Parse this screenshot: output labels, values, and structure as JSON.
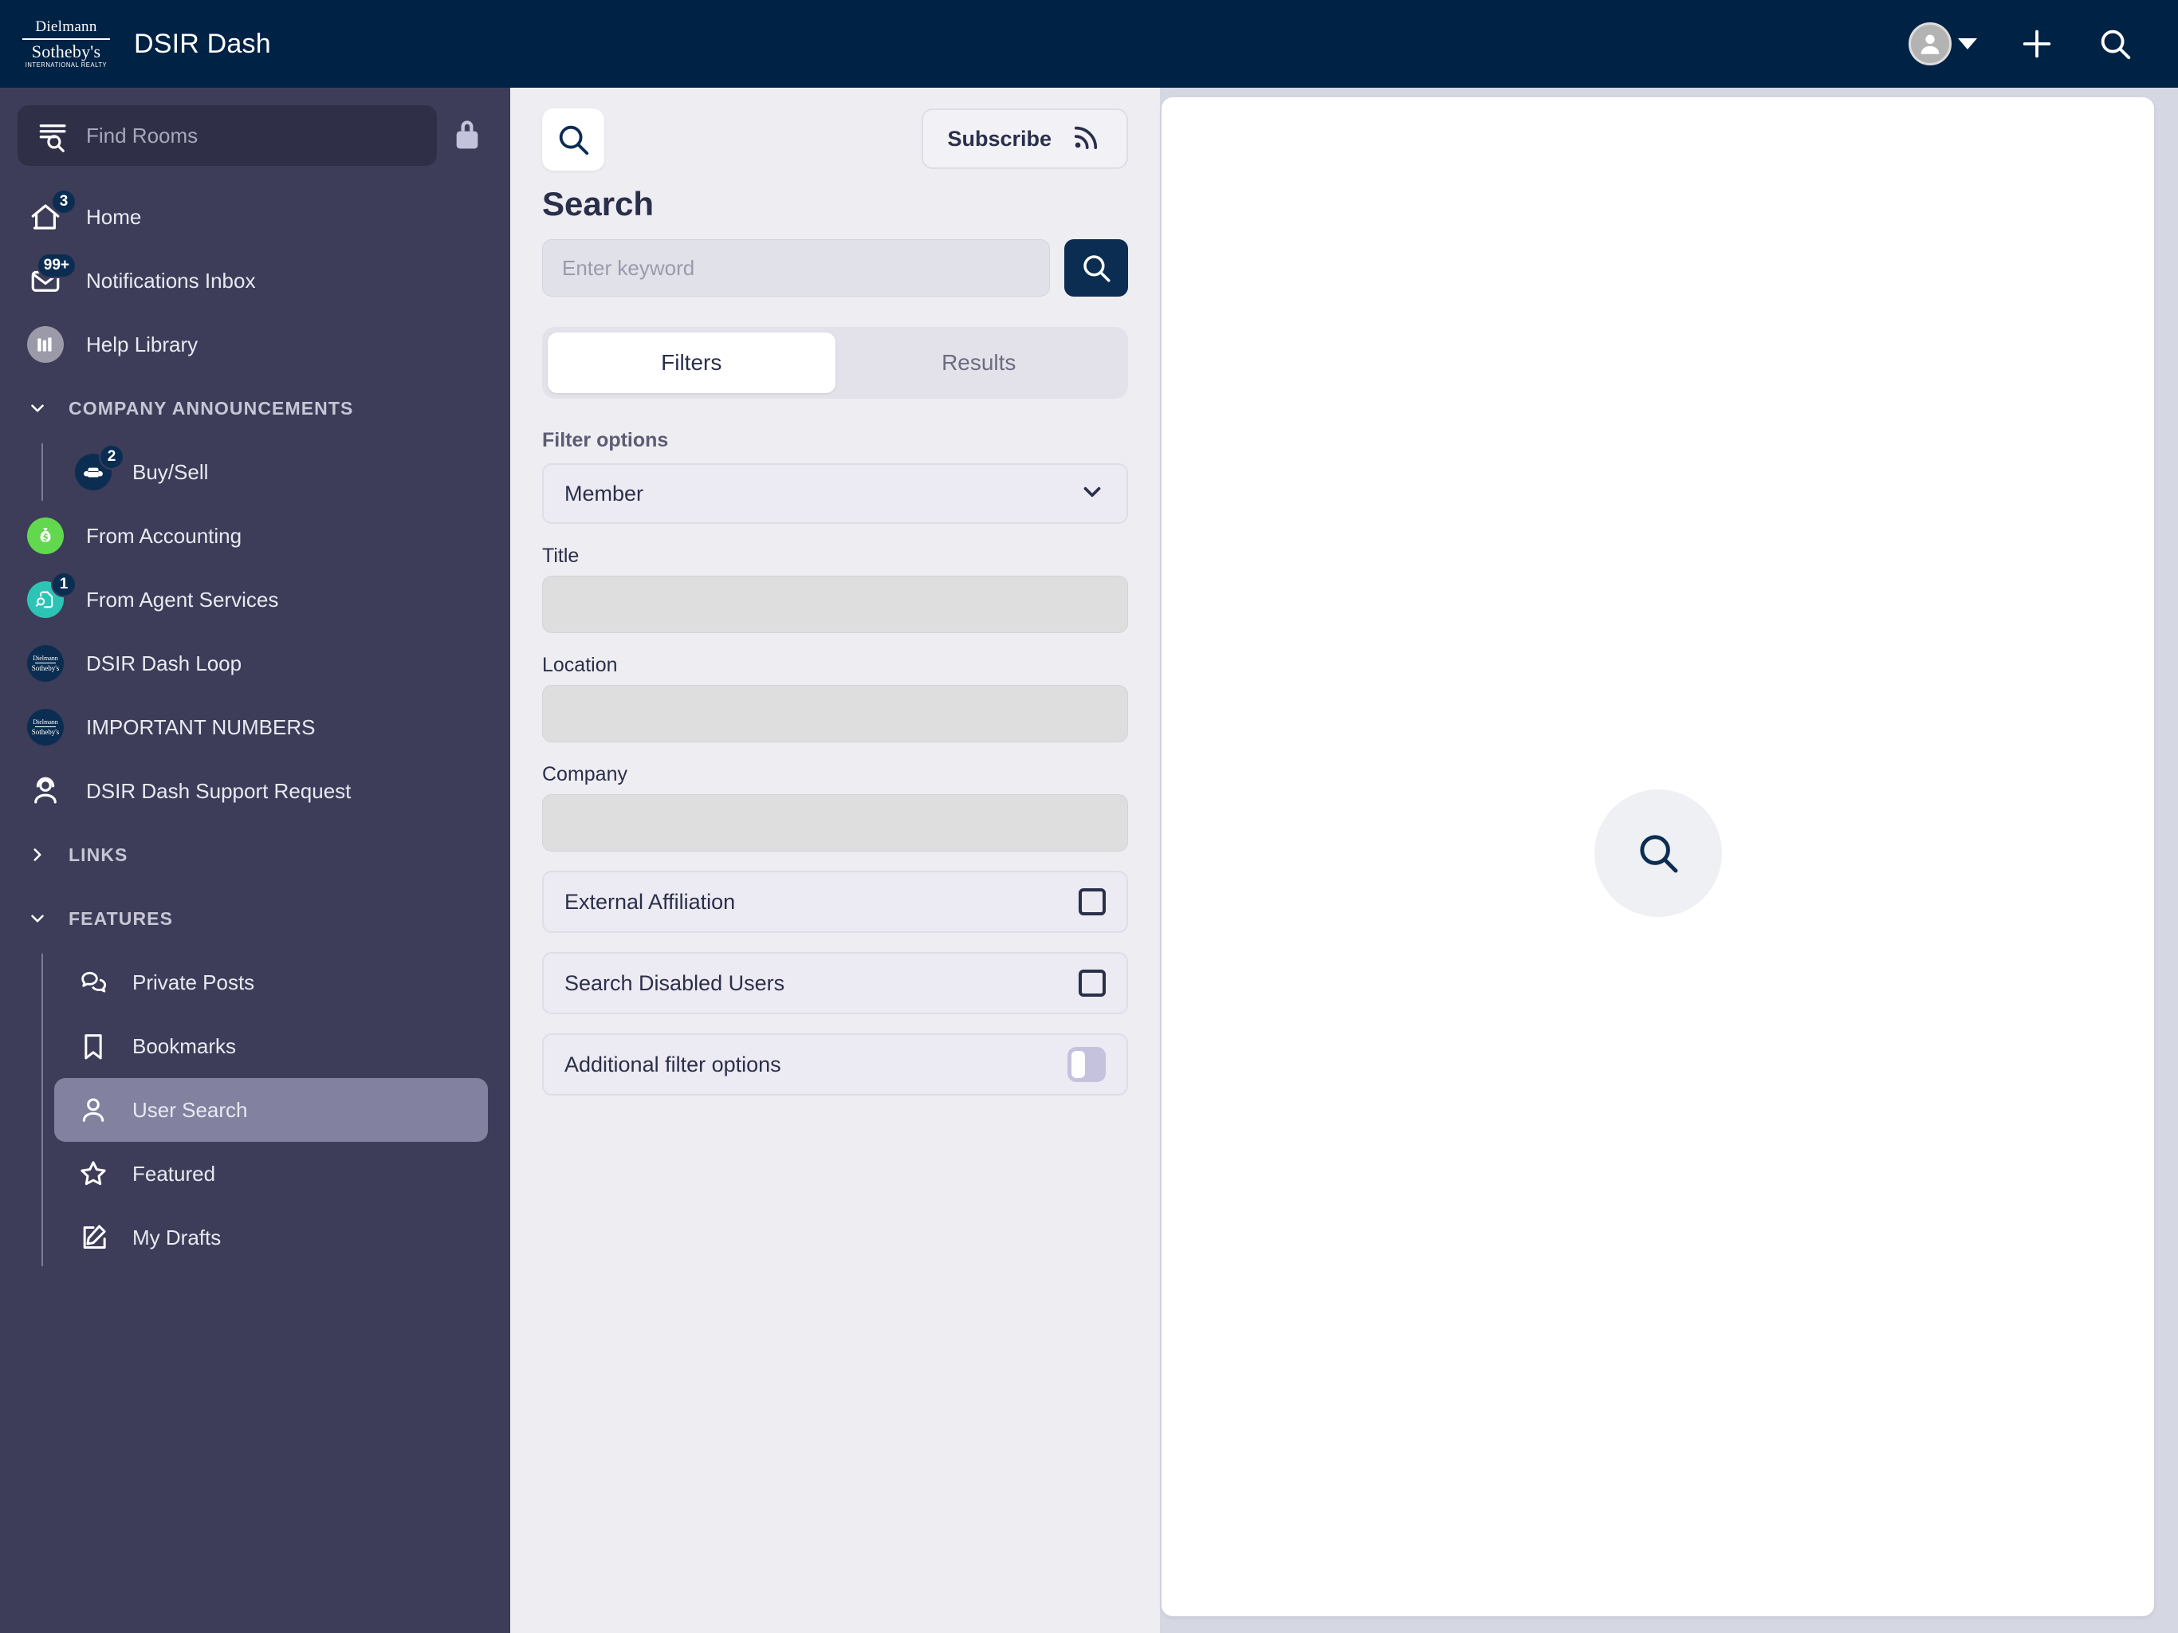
{
  "header": {
    "logo": {
      "line1": "Dielmann",
      "line2": "Sotheby's",
      "line3": "INTERNATIONAL REALTY"
    },
    "app_title": "DSIR Dash",
    "icons": {
      "avatar": "avatar-icon",
      "caret": "chevron-down-icon",
      "plus": "plus-icon",
      "search": "search-icon"
    },
    "colors": {
      "bar": "#002244"
    }
  },
  "sidebar": {
    "find_rooms_placeholder": "Find Rooms",
    "lock_icon": "lock-icon",
    "bg_color": "#3d3d59",
    "items": [
      {
        "label": "Home",
        "icon": "home-icon",
        "badge": "3",
        "icon_style": "plain"
      },
      {
        "label": "Notifications Inbox",
        "icon": "envelope-icon",
        "badge": "99+",
        "icon_style": "plain"
      },
      {
        "label": "Help Library",
        "icon": "books-icon",
        "badge": "",
        "icon_style": "gray-circle"
      }
    ],
    "group_announcements": {
      "title": "COMPANY ANNOUNCEMENTS",
      "chevron": "chevron-down-icon",
      "expanded": true,
      "children": [
        {
          "label": "Buy/Sell",
          "icon": "armchair-icon",
          "badge": "2",
          "icon_style": "navy-circle"
        }
      ]
    },
    "items2": [
      {
        "label": "From Accounting",
        "icon": "money-bag-icon",
        "badge": "",
        "icon_style": "green-circle"
      },
      {
        "label": "From Agent Services",
        "icon": "document-search-icon",
        "badge": "1",
        "icon_style": "teal-circle"
      },
      {
        "label": "DSIR Dash Loop",
        "icon": "sothebys-logo-icon",
        "badge": "",
        "icon_style": "navy-logo"
      },
      {
        "label": "IMPORTANT NUMBERS",
        "icon": "sothebys-logo-icon",
        "badge": "",
        "icon_style": "navy-logo"
      },
      {
        "label": "DSIR Dash Support Request",
        "icon": "headset-person-icon",
        "badge": "",
        "icon_style": "plain"
      }
    ],
    "group_links": {
      "title": "LINKS",
      "chevron": "chevron-right-icon",
      "expanded": false
    },
    "group_features": {
      "title": "FEATURES",
      "chevron": "chevron-down-icon",
      "expanded": true,
      "children": [
        {
          "label": "Private Posts",
          "icon": "chat-bubbles-icon",
          "active": false
        },
        {
          "label": "Bookmarks",
          "icon": "bookmark-icon",
          "active": false
        },
        {
          "label": "User Search",
          "icon": "person-icon",
          "active": true
        },
        {
          "label": "Featured",
          "icon": "star-icon",
          "active": false
        },
        {
          "label": "My Drafts",
          "icon": "pencil-square-icon",
          "active": false
        }
      ]
    }
  },
  "search_panel": {
    "tile_icon": "search-icon",
    "subscribe_label": "Subscribe",
    "subscribe_icon": "rss-icon",
    "title": "Search",
    "keyword_placeholder": "Enter keyword",
    "keyword_value": "",
    "search_button_icon": "search-icon",
    "tabs": [
      {
        "label": "Filters",
        "active": true
      },
      {
        "label": "Results",
        "active": false
      }
    ],
    "filter_options_label": "Filter options",
    "member_select": {
      "value": "Member",
      "chevron": "chevron-down-icon"
    },
    "fields": [
      {
        "label": "Title",
        "value": ""
      },
      {
        "label": "Location",
        "value": ""
      },
      {
        "label": "Company",
        "value": ""
      }
    ],
    "options": [
      {
        "label": "External Affiliation",
        "control": "checkbox",
        "checked": false
      },
      {
        "label": "Search Disabled Users",
        "control": "checkbox",
        "checked": false
      },
      {
        "label": "Additional filter options",
        "control": "toggle",
        "checked": false
      }
    ],
    "bg_color": "#eeedf2"
  },
  "content": {
    "empty_state_icon": "search-icon",
    "bg_color": "#ffffff"
  }
}
